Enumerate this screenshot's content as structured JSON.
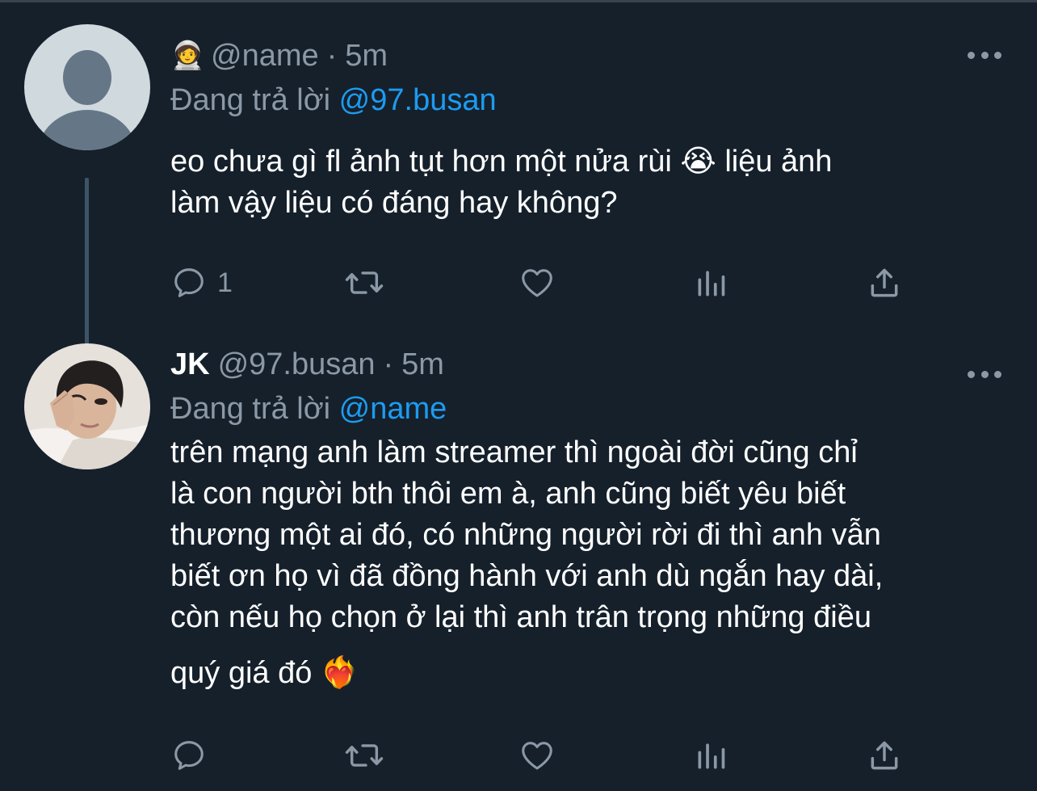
{
  "colors": {
    "background": "#15202b",
    "text_primary": "#ffffff",
    "text_secondary": "#8b98a5",
    "link": "#1d9bf0",
    "thread_line": "#3d5466"
  },
  "tweets": [
    {
      "badge": "🧑‍🚀",
      "handle": "@name",
      "separator": "·",
      "time": "5m",
      "replying_label": "Đang trả lời",
      "replying_to": "@97.busan",
      "text_lines": [
        "eo chưa gì fl ảnh tụt hơn một nửa rùi 😭   liệu ảnh",
        "làm vậy liệu có đáng hay không?"
      ],
      "reply_count": "1",
      "avatar": "default-avatar"
    },
    {
      "display_name": "JK",
      "handle": "@97.busan",
      "separator": "·",
      "time": "5m",
      "replying_label": "Đang trả lời",
      "replying_to": "@name",
      "text_lines": [
        "trên mạng anh làm streamer thì ngoài đời cũng chỉ",
        "là con người bth thôi em à, anh cũng biết yêu biết",
        "thương một ai đó, có những người rời đi thì anh vẫn",
        "biết ơn họ vì đã đồng hành với anh dù ngắn hay dài,",
        "còn nếu họ chọn ở lại thì anh trân trọng những điều",
        "quý giá đó ❤️‍🔥"
      ],
      "reply_count": "",
      "avatar": "profile-photo"
    }
  ],
  "icons": {
    "reply": "reply-icon",
    "retweet": "retweet-icon",
    "like": "heart-icon",
    "stats": "analytics-icon",
    "share": "share-icon",
    "more": "more-icon"
  }
}
